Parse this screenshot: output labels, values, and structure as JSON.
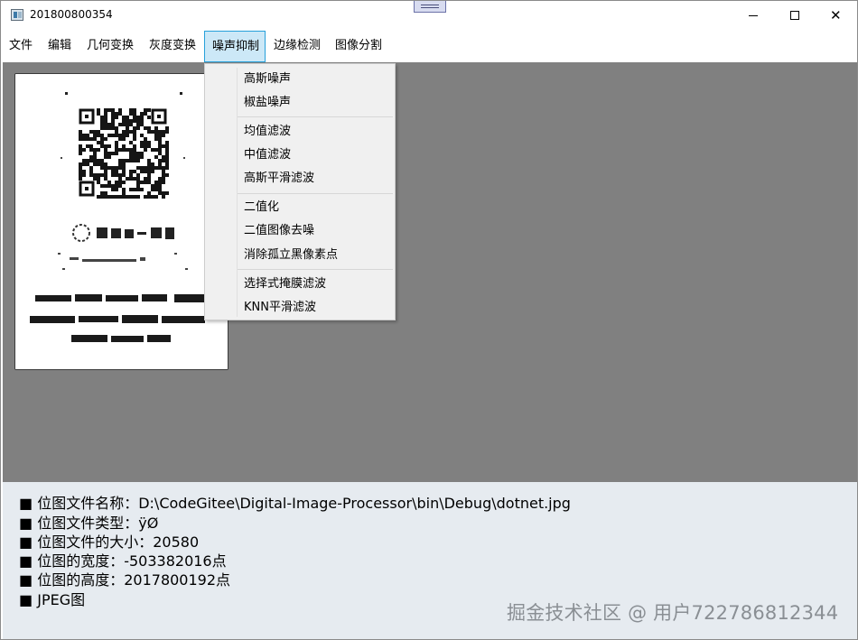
{
  "window": {
    "title": "201800800354"
  },
  "titlebar": {
    "minimize_icon": "minimize-icon",
    "maximize_icon": "maximize-icon",
    "close_icon": "close-icon",
    "close_glyph": "✕"
  },
  "menubar": {
    "items": [
      {
        "label": "文件"
      },
      {
        "label": "编辑"
      },
      {
        "label": "几何变换"
      },
      {
        "label": "灰度变换"
      },
      {
        "label": "噪声抑制"
      },
      {
        "label": "边缘检测"
      },
      {
        "label": "图像分割"
      }
    ],
    "active": "噪声抑制"
  },
  "dropdown": {
    "items": [
      {
        "label": "高斯噪声"
      },
      {
        "label": "椒盐噪声"
      },
      {
        "label": "均值滤波"
      },
      {
        "label": "中值滤波"
      },
      {
        "label": "高斯平滑滤波"
      },
      {
        "label": "二值化"
      },
      {
        "label": "二值图像去噪"
      },
      {
        "label": "消除孤立黑像素点"
      },
      {
        "label": "选择式掩膜滤波"
      },
      {
        "label": "KNN平滑滤波"
      }
    ]
  },
  "info": {
    "bullet": "■",
    "lines": [
      "位图文件名称：D:\\CodeGitee\\Digital-Image-Processor\\bin\\Debug\\dotnet.jpg",
      "位图文件类型：ÿØ",
      "位图文件的大小：20580",
      "位图的宽度：-503382016点",
      "位图的高度：2017800192点",
      "JPEG图"
    ]
  },
  "watermark": "掘金技术社区 @ 用户722786812344",
  "colors": {
    "canvas": "#808080",
    "info_panel": "#e6ebf0",
    "menu_highlight": "#cce8f7",
    "menu_highlight_border": "#26a0da",
    "dropdown_bg": "#f0f0f0"
  }
}
